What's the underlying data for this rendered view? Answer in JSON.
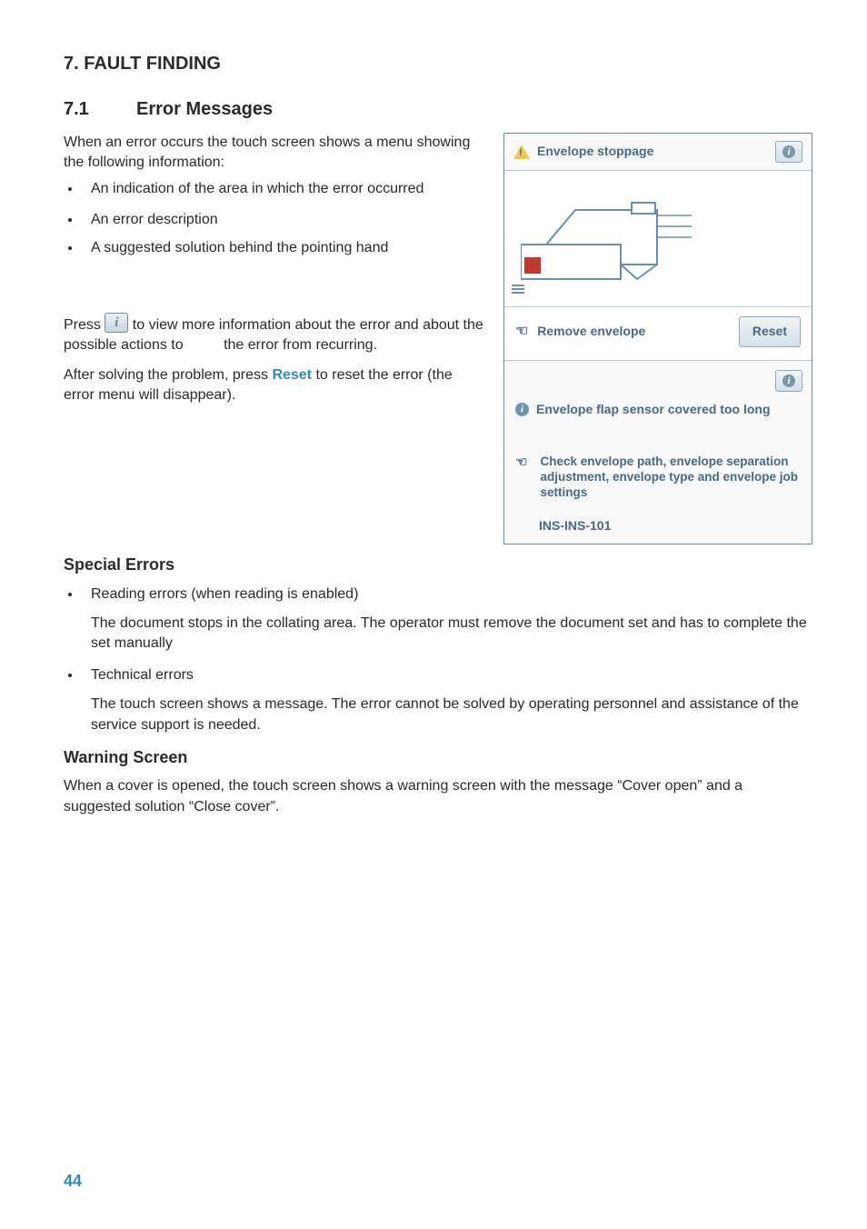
{
  "section_heading": "7.    FAULT FINDING",
  "sub_heading_num": "7.1",
  "sub_heading_text": "Error Messages",
  "intro": "When an error occurs the touch screen shows a menu showing the following information:",
  "bullets_intro": [
    "An indication of the area in which the error occurred",
    "An error description",
    "A suggested solution behind the pointing hand"
  ],
  "press_before": "Press ",
  "press_after_1": " to view more information about the error and about the possible actions to ",
  "press_after_2": " the error from recurring.",
  "after_solving_1": "After solving the problem, press ",
  "reset_word": "Reset",
  "after_solving_2": " to reset the error (the error menu will disappear).",
  "special_errors_heading": "Special Errors",
  "reading_bullet": "Reading errors (when reading is enabled)",
  "reading_desc": "The document stops in the collating area. The operator must remove the document set and has to complete the set manually",
  "tech_bullet": "Technical errors",
  "tech_desc": "The touch screen shows a message. The error cannot be solved by operating personnel and assistance of the service support is needed.",
  "warning_heading": "Warning Screen",
  "warning_text": "When a cover is opened, the touch screen shows a warning screen with the message “Cover open” and a suggested solution “Close cover”.",
  "page_number": "44",
  "device": {
    "title": "Envelope stoppage",
    "action_text": "Remove envelope",
    "reset_label": "Reset",
    "detail_title": "Envelope flap sensor covered too long",
    "check_text": "Check envelope path, envelope separation adjustment, envelope type and envelope job settings",
    "error_code": "INS-INS-101"
  }
}
